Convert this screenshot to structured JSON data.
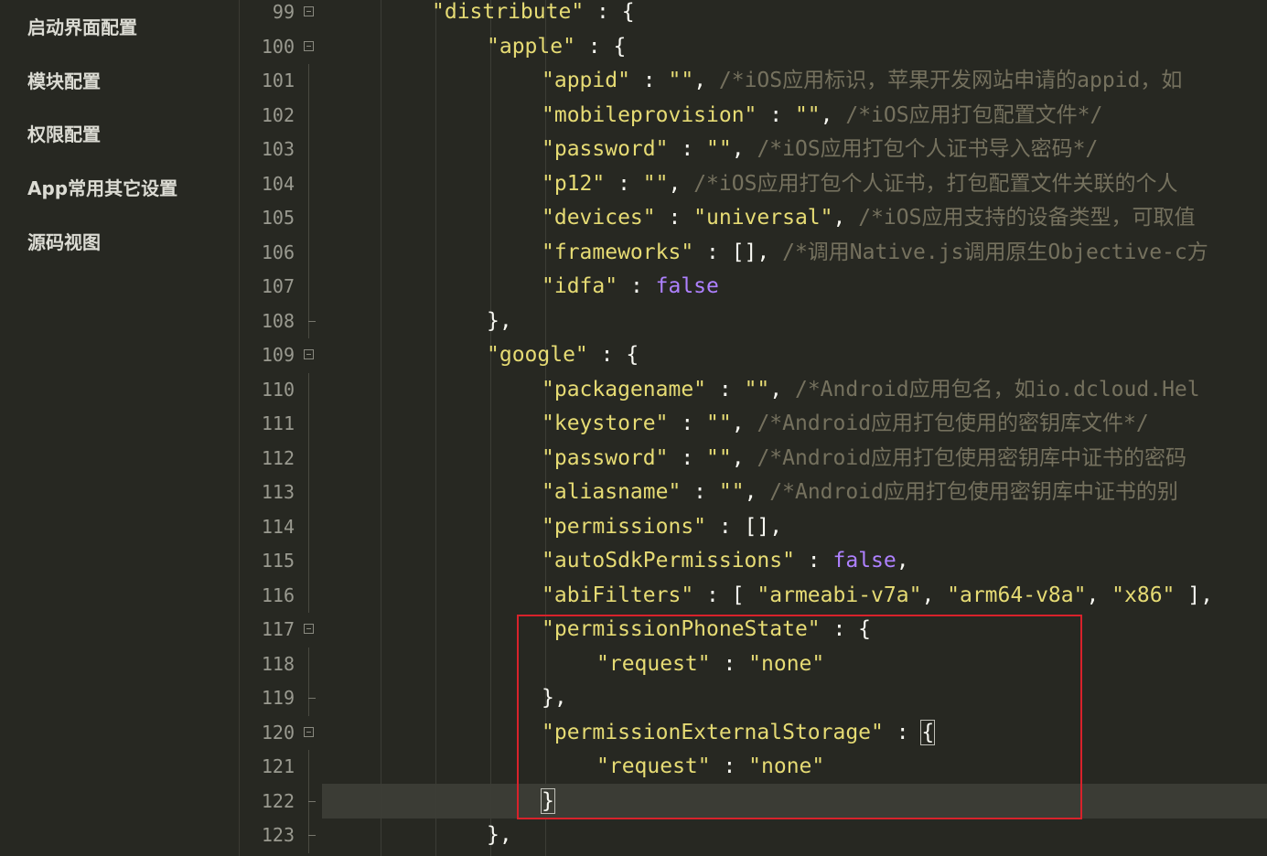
{
  "sidebar": {
    "items": [
      {
        "label": "启动界面配置"
      },
      {
        "label": "模块配置"
      },
      {
        "label": "权限配置"
      },
      {
        "label": "App常用其它设置"
      },
      {
        "label": "源码视图"
      }
    ]
  },
  "editor": {
    "lines": [
      {
        "num": "99",
        "fold": "open",
        "indent": 8,
        "tokens": [
          {
            "t": "\"distribute\"",
            "c": "str"
          },
          {
            "t": " : {",
            "c": "key"
          }
        ]
      },
      {
        "num": "100",
        "fold": "open",
        "indent": 12,
        "tokens": [
          {
            "t": "\"apple\"",
            "c": "str"
          },
          {
            "t": " : {",
            "c": "key"
          }
        ]
      },
      {
        "num": "101",
        "fold": "guide",
        "indent": 16,
        "tokens": [
          {
            "t": "\"appid\"",
            "c": "str"
          },
          {
            "t": " : ",
            "c": "key"
          },
          {
            "t": "\"\"",
            "c": "str"
          },
          {
            "t": ", ",
            "c": "key"
          },
          {
            "t": "/*iOS应用标识，苹果开发网站申请的appid，如",
            "c": "cmt"
          }
        ]
      },
      {
        "num": "102",
        "fold": "guide",
        "indent": 16,
        "tokens": [
          {
            "t": "\"mobileprovision\"",
            "c": "str"
          },
          {
            "t": " : ",
            "c": "key"
          },
          {
            "t": "\"\"",
            "c": "str"
          },
          {
            "t": ", ",
            "c": "key"
          },
          {
            "t": "/*iOS应用打包配置文件*/",
            "c": "cmt"
          }
        ]
      },
      {
        "num": "103",
        "fold": "guide",
        "indent": 16,
        "tokens": [
          {
            "t": "\"password\"",
            "c": "str"
          },
          {
            "t": " : ",
            "c": "key"
          },
          {
            "t": "\"\"",
            "c": "str"
          },
          {
            "t": ", ",
            "c": "key"
          },
          {
            "t": "/*iOS应用打包个人证书导入密码*/",
            "c": "cmt"
          }
        ]
      },
      {
        "num": "104",
        "fold": "guide",
        "indent": 16,
        "tokens": [
          {
            "t": "\"p12\"",
            "c": "str"
          },
          {
            "t": " : ",
            "c": "key"
          },
          {
            "t": "\"\"",
            "c": "str"
          },
          {
            "t": ", ",
            "c": "key"
          },
          {
            "t": "/*iOS应用打包个人证书，打包配置文件关联的个人",
            "c": "cmt"
          }
        ]
      },
      {
        "num": "105",
        "fold": "guide",
        "indent": 16,
        "tokens": [
          {
            "t": "\"devices\"",
            "c": "str"
          },
          {
            "t": " : ",
            "c": "key"
          },
          {
            "t": "\"universal\"",
            "c": "str"
          },
          {
            "t": ", ",
            "c": "key"
          },
          {
            "t": "/*iOS应用支持的设备类型，可取值",
            "c": "cmt"
          }
        ]
      },
      {
        "num": "106",
        "fold": "guide",
        "indent": 16,
        "tokens": [
          {
            "t": "\"frameworks\"",
            "c": "str"
          },
          {
            "t": " : [], ",
            "c": "key"
          },
          {
            "t": "/*调用Native.js调用原生Objective-c方",
            "c": "cmt"
          }
        ]
      },
      {
        "num": "107",
        "fold": "guide",
        "indent": 16,
        "tokens": [
          {
            "t": "\"idfa\"",
            "c": "str"
          },
          {
            "t": " : ",
            "c": "key"
          },
          {
            "t": "false",
            "c": "kw"
          }
        ]
      },
      {
        "num": "108",
        "fold": "end",
        "indent": 12,
        "tokens": [
          {
            "t": "},",
            "c": "key"
          }
        ]
      },
      {
        "num": "109",
        "fold": "open",
        "indent": 12,
        "tokens": [
          {
            "t": "\"google\"",
            "c": "str"
          },
          {
            "t": " : {",
            "c": "key"
          }
        ]
      },
      {
        "num": "110",
        "fold": "guide",
        "indent": 16,
        "tokens": [
          {
            "t": "\"packagename\"",
            "c": "str"
          },
          {
            "t": " : ",
            "c": "key"
          },
          {
            "t": "\"\"",
            "c": "str"
          },
          {
            "t": ", ",
            "c": "key"
          },
          {
            "t": "/*Android应用包名，如io.dcloud.Hel",
            "c": "cmt"
          }
        ]
      },
      {
        "num": "111",
        "fold": "guide",
        "indent": 16,
        "tokens": [
          {
            "t": "\"keystore\"",
            "c": "str"
          },
          {
            "t": " : ",
            "c": "key"
          },
          {
            "t": "\"\"",
            "c": "str"
          },
          {
            "t": ", ",
            "c": "key"
          },
          {
            "t": "/*Android应用打包使用的密钥库文件*/",
            "c": "cmt"
          }
        ]
      },
      {
        "num": "112",
        "fold": "guide",
        "indent": 16,
        "tokens": [
          {
            "t": "\"password\"",
            "c": "str"
          },
          {
            "t": " : ",
            "c": "key"
          },
          {
            "t": "\"\"",
            "c": "str"
          },
          {
            "t": ", ",
            "c": "key"
          },
          {
            "t": "/*Android应用打包使用密钥库中证书的密码",
            "c": "cmt"
          }
        ]
      },
      {
        "num": "113",
        "fold": "guide",
        "indent": 16,
        "tokens": [
          {
            "t": "\"aliasname\"",
            "c": "str"
          },
          {
            "t": " : ",
            "c": "key"
          },
          {
            "t": "\"\"",
            "c": "str"
          },
          {
            "t": ", ",
            "c": "key"
          },
          {
            "t": "/*Android应用打包使用密钥库中证书的别",
            "c": "cmt"
          }
        ]
      },
      {
        "num": "114",
        "fold": "guide",
        "indent": 16,
        "tokens": [
          {
            "t": "\"permissions\"",
            "c": "str"
          },
          {
            "t": " : [],",
            "c": "key"
          }
        ]
      },
      {
        "num": "115",
        "fold": "guide",
        "indent": 16,
        "tokens": [
          {
            "t": "\"autoSdkPermissions\"",
            "c": "str"
          },
          {
            "t": " : ",
            "c": "key"
          },
          {
            "t": "false",
            "c": "kw"
          },
          {
            "t": ",",
            "c": "key"
          }
        ]
      },
      {
        "num": "116",
        "fold": "guide",
        "indent": 16,
        "tokens": [
          {
            "t": "\"abiFilters\"",
            "c": "str"
          },
          {
            "t": " : [ ",
            "c": "key"
          },
          {
            "t": "\"armeabi-v7a\"",
            "c": "str"
          },
          {
            "t": ", ",
            "c": "key"
          },
          {
            "t": "\"arm64-v8a\"",
            "c": "str"
          },
          {
            "t": ", ",
            "c": "key"
          },
          {
            "t": "\"x86\"",
            "c": "str"
          },
          {
            "t": " ],",
            "c": "key"
          }
        ]
      },
      {
        "num": "117",
        "fold": "open",
        "indent": 16,
        "tokens": [
          {
            "t": "\"permissionPhoneState\"",
            "c": "str"
          },
          {
            "t": " : {",
            "c": "key"
          }
        ]
      },
      {
        "num": "118",
        "fold": "guide",
        "indent": 20,
        "tokens": [
          {
            "t": "\"request\"",
            "c": "str"
          },
          {
            "t": " : ",
            "c": "key"
          },
          {
            "t": "\"none\"",
            "c": "str"
          }
        ]
      },
      {
        "num": "119",
        "fold": "end",
        "indent": 16,
        "tokens": [
          {
            "t": "},",
            "c": "key"
          }
        ]
      },
      {
        "num": "120",
        "fold": "open",
        "indent": 16,
        "tokens": [
          {
            "t": "\"permissionExternalStorage\"",
            "c": "str"
          },
          {
            "t": " : ",
            "c": "key"
          },
          {
            "t": "{",
            "c": "key",
            "match": true
          }
        ]
      },
      {
        "num": "121",
        "fold": "guide",
        "indent": 20,
        "tokens": [
          {
            "t": "\"request\"",
            "c": "str"
          },
          {
            "t": " : ",
            "c": "key"
          },
          {
            "t": "\"none\"",
            "c": "str"
          }
        ]
      },
      {
        "num": "122",
        "fold": "end",
        "indent": 16,
        "current": true,
        "tokens": [
          {
            "t": "}",
            "c": "key",
            "match": true
          }
        ]
      },
      {
        "num": "123",
        "fold": "end",
        "indent": 12,
        "tokens": [
          {
            "t": "},",
            "c": "key"
          }
        ]
      }
    ]
  }
}
